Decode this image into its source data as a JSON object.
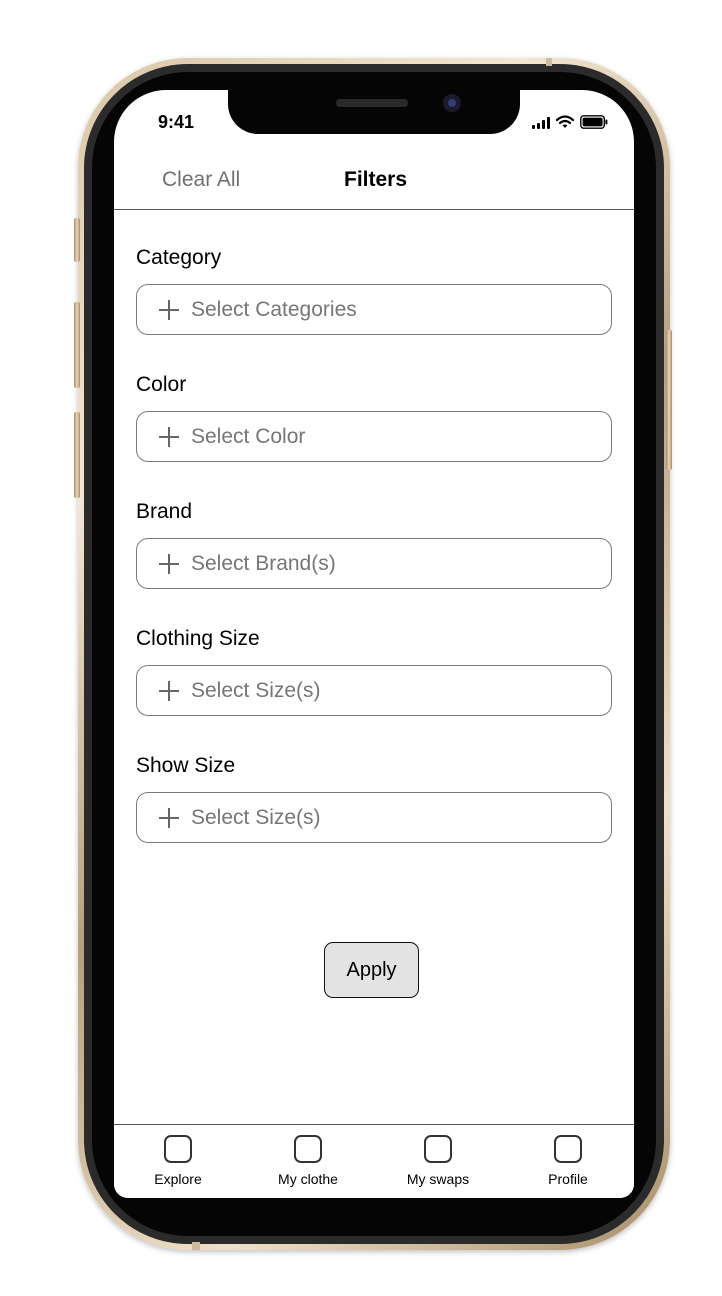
{
  "status_bar": {
    "time": "9:41"
  },
  "nav": {
    "left_action": "Clear All",
    "title": "Filters"
  },
  "filters": [
    {
      "label": "Category",
      "placeholder": "Select Categories",
      "icon": "plus-icon"
    },
    {
      "label": "Color",
      "placeholder": "Select Color",
      "icon": "plus-icon"
    },
    {
      "label": "Brand",
      "placeholder": "Select Brand(s)",
      "icon": "plus-icon"
    },
    {
      "label": "Clothing Size",
      "placeholder": "Select Size(s)",
      "icon": "plus-icon"
    },
    {
      "label": "Show Size",
      "placeholder": "Select Size(s)",
      "icon": "plus-icon"
    }
  ],
  "apply_label": "Apply",
  "tabs": [
    {
      "label": "Explore",
      "icon": "square-icon"
    },
    {
      "label": "My clothe",
      "icon": "square-icon"
    },
    {
      "label": "My swaps",
      "icon": "square-icon"
    },
    {
      "label": "Profile",
      "icon": "square-icon"
    }
  ]
}
